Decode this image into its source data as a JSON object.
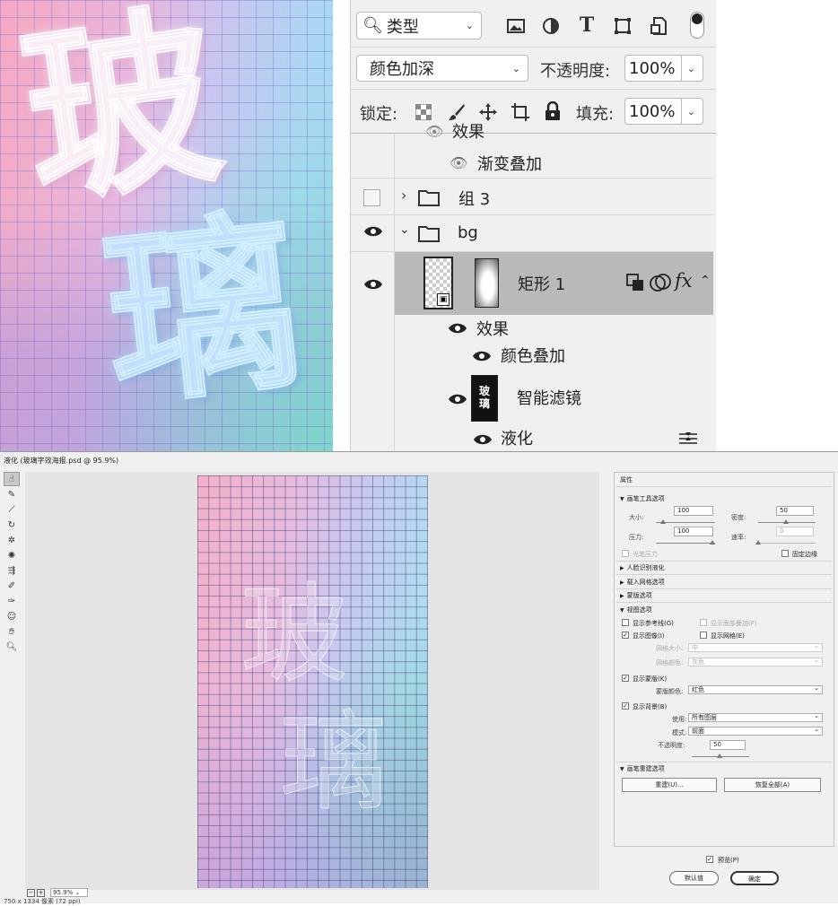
{
  "poster": {
    "char1": "玻",
    "char2": "璃"
  },
  "layers_panel": {
    "filter_kind": "类型",
    "blend_mode": "颜色加深",
    "opacity_label": "不透明度:",
    "opacity_value": "100%",
    "lock_label": "锁定:",
    "fill_label": "填充:",
    "fill_value": "100%",
    "rows": {
      "effect_partial": "效果",
      "gradient_overlay": "渐变叠加",
      "group3": "组 3",
      "bg_group": "bg",
      "rect1": "矩形 1",
      "effects": "效果",
      "color_overlay": "颜色叠加",
      "smart_filters": "智能滤镜",
      "liquify": "液化",
      "thumb_text": "玻璃"
    }
  },
  "liquify_dialog": {
    "title": "液化 (玻璃字效海报.psd @ 95.9%)",
    "zoom_value": "95.9%",
    "status": "750 x 1334 像素 (72 ppi)",
    "properties": {
      "panel_title": "属性",
      "brush_tool_options": "画笔工具选项",
      "size_label": "大小:",
      "size_value": "100",
      "density_label": "密度:",
      "density_value": "50",
      "pressure_label": "压力:",
      "pressure_value": "100",
      "rate_label": "速率:",
      "rate_value": "0",
      "stylus_pressure": "光笔压力",
      "pin_edges": "固定边缘",
      "face_aware": "人脸识别液化",
      "load_mesh": "载入网格选项",
      "mask_options": "蒙版选项",
      "view_options": "视图选项",
      "show_guides": "显示参考线(G)",
      "show_face_overlay": "显示面部叠加(F)",
      "show_image": "显示图像(I)",
      "show_mesh": "显示网格(E)",
      "mesh_size_label": "网格大小:",
      "mesh_size_value": "中",
      "mesh_color_label": "网格颜色:",
      "mesh_color_value": "灰色",
      "show_mask": "显示蒙版(K)",
      "mask_color_label": "蒙版颜色:",
      "mask_color_value": "红色",
      "show_backdrop": "显示背景(B)",
      "use_label": "使用:",
      "use_value": "所有图层",
      "mode_label": "模式:",
      "mode_value": "前面",
      "opacity_label": "不透明度:",
      "opacity_value": "50",
      "brush_reconstruct": "画笔重建选项",
      "reconstruct_btn": "重建(U)...",
      "restore_all_btn": "恢复全部(A)"
    },
    "preview_label": "预览(P)",
    "default_btn": "默认值",
    "ok_btn": "确定"
  }
}
